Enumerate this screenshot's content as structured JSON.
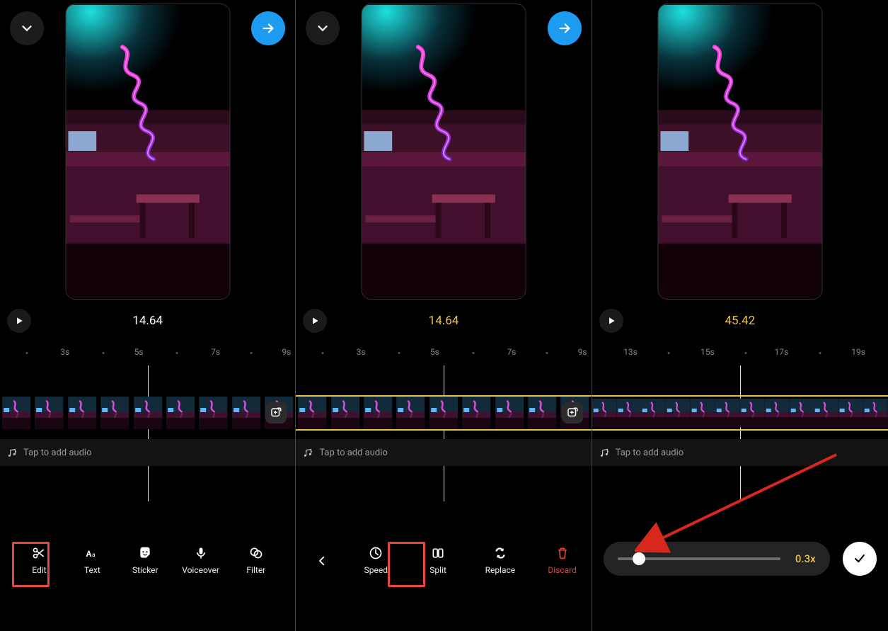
{
  "screen1": {
    "timecode": "14.64",
    "timecode_color": "#ffffff",
    "ruler": [
      "3s",
      "5s",
      "7s",
      "9s"
    ],
    "audio_hint": "Tap to add audio",
    "tools": [
      {
        "label": "Edit"
      },
      {
        "label": "Text"
      },
      {
        "label": "Sticker"
      },
      {
        "label": "Voiceover"
      },
      {
        "label": "Filter"
      }
    ],
    "highlight_tool_index": 0
  },
  "screen2": {
    "timecode": "14.64",
    "timecode_color": "#e8c34a",
    "ruler": [
      "3s",
      "5s",
      "7s",
      "9s"
    ],
    "audio_hint": "Tap to add audio",
    "tools": [
      {
        "label": "Speed"
      },
      {
        "label": "Split"
      },
      {
        "label": "Replace"
      },
      {
        "label": "Discard",
        "discard": true
      }
    ],
    "highlight_tool_index": 0,
    "selected_clip": true
  },
  "screen3": {
    "timecode": "45.42",
    "timecode_color": "#e8c34a",
    "ruler": [
      "13s",
      "15s",
      "17s",
      "19s"
    ],
    "audio_hint": "Tap to add audio",
    "speed_value": "0.3x",
    "slider_pos_pct": 13,
    "selected_clip": true
  }
}
